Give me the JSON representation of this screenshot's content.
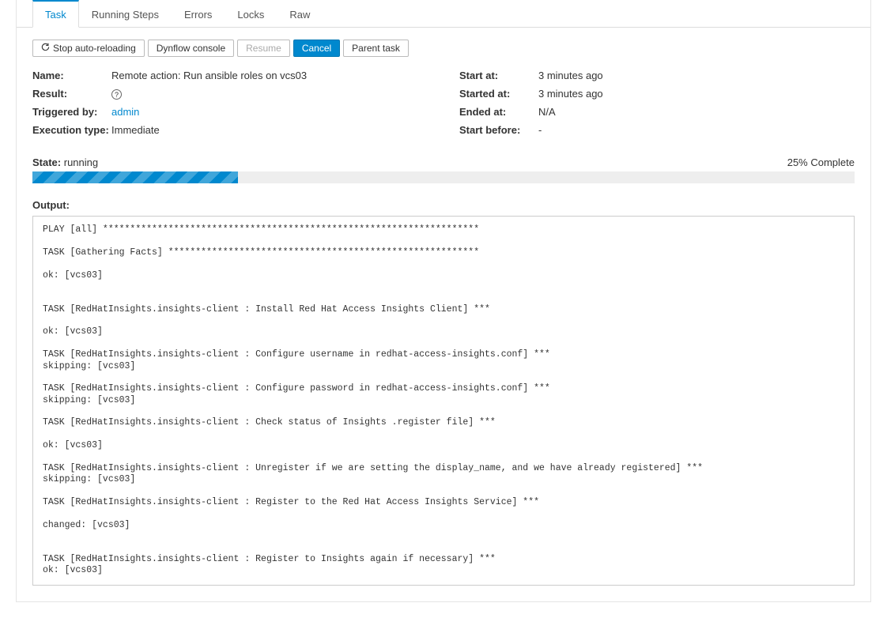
{
  "tabs": [
    {
      "label": "Task",
      "active": true
    },
    {
      "label": "Running Steps",
      "active": false
    },
    {
      "label": "Errors",
      "active": false
    },
    {
      "label": "Locks",
      "active": false
    },
    {
      "label": "Raw",
      "active": false
    }
  ],
  "buttons": {
    "stop_reload": "Stop auto-reloading",
    "dynflow": "Dynflow console",
    "resume": "Resume",
    "cancel": "Cancel",
    "parent": "Parent task"
  },
  "details_left": {
    "name_label": "Name:",
    "name_value": "Remote action: Run ansible roles on vcs03",
    "result_label": "Result:",
    "triggered_label": "Triggered by:",
    "triggered_value": "admin",
    "exec_label": "Execution type:",
    "exec_value": "Immediate"
  },
  "details_right": {
    "start_at_label": "Start at:",
    "start_at_value": "3 minutes ago",
    "started_at_label": "Started at:",
    "started_at_value": "3 minutes ago",
    "ended_at_label": "Ended at:",
    "ended_at_value": "N/A",
    "start_before_label": "Start before:",
    "start_before_value": "-"
  },
  "state": {
    "label": "State:",
    "value": "running",
    "complete_text": "25% Complete",
    "percent": 25
  },
  "output_label": "Output:",
  "output_text": "PLAY [all] *********************************************************************\n\nTASK [Gathering Facts] *********************************************************\n\nok: [vcs03]\n\n\nTASK [RedHatInsights.insights-client : Install Red Hat Access Insights Client] ***\n\nok: [vcs03]\n\nTASK [RedHatInsights.insights-client : Configure username in redhat-access-insights.conf] ***\nskipping: [vcs03]\n\nTASK [RedHatInsights.insights-client : Configure password in redhat-access-insights.conf] ***\nskipping: [vcs03]\n\nTASK [RedHatInsights.insights-client : Check status of Insights .register file] ***\n\nok: [vcs03]\n\nTASK [RedHatInsights.insights-client : Unregister if we are setting the display_name, and we have already registered] ***\nskipping: [vcs03]\n\nTASK [RedHatInsights.insights-client : Register to the Red Hat Access Insights Service] ***\n\nchanged: [vcs03]\n\n\nTASK [RedHatInsights.insights-client : Register to Insights again if necessary] ***\nok: [vcs03]"
}
